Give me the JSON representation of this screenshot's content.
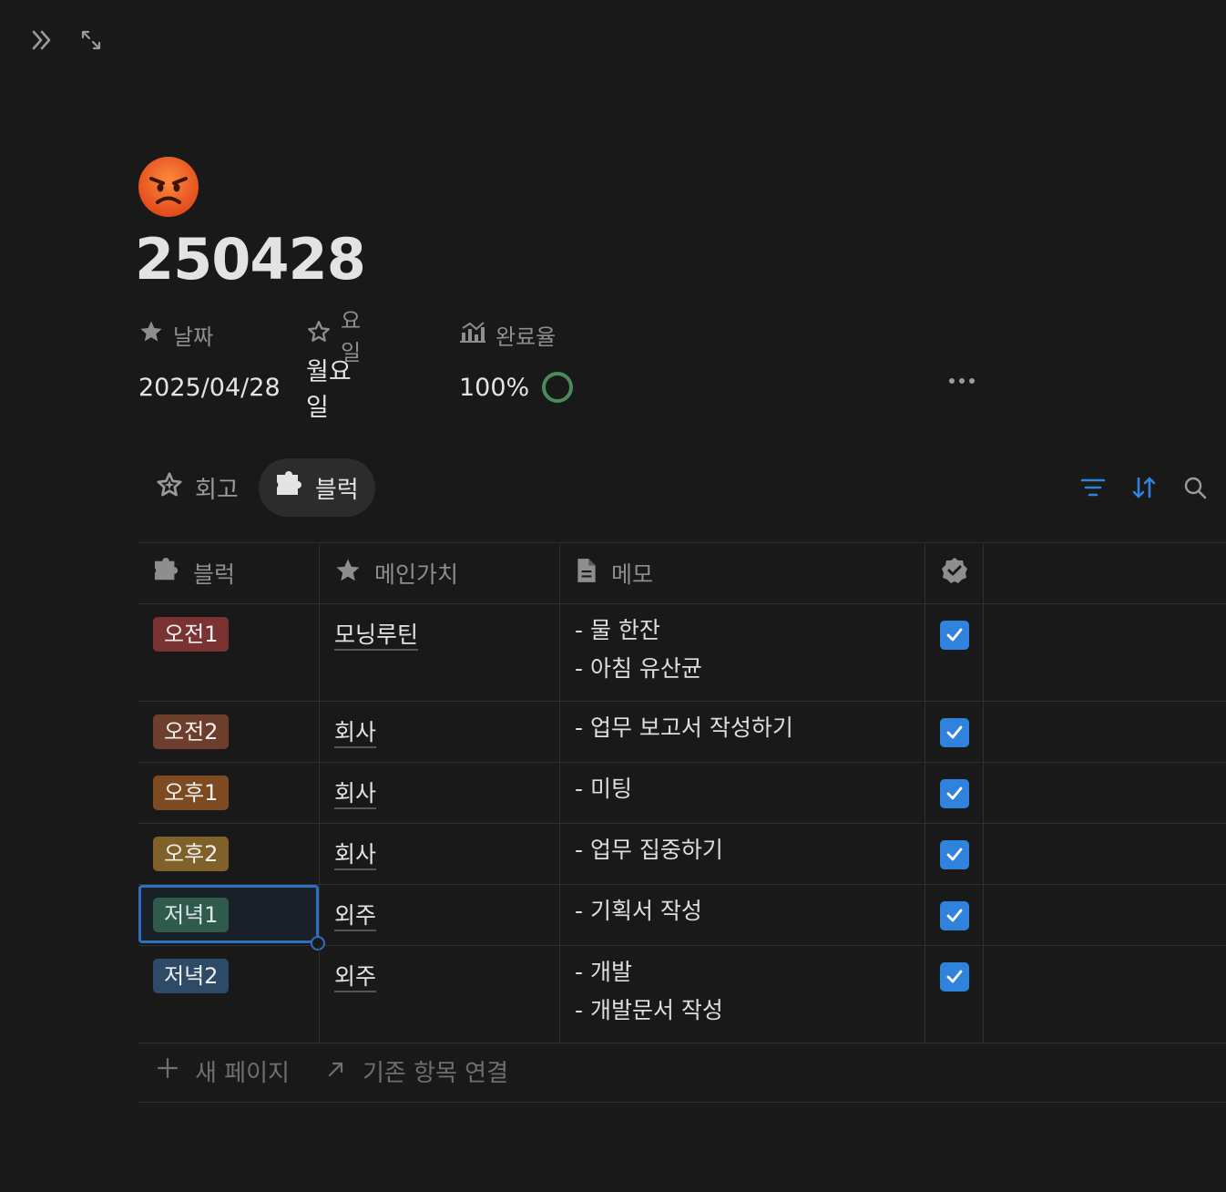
{
  "page": {
    "title": "250428"
  },
  "properties": [
    {
      "label": "날짜",
      "value": "2025/04/28",
      "icon": "star-filled-icon"
    },
    {
      "label": "요일",
      "value": "월요일",
      "icon": "star-outline-icon"
    },
    {
      "label": "완료율",
      "value": "100%",
      "icon": "chart-icon"
    }
  ],
  "tabs": [
    {
      "label": "회고",
      "icon": "sparkle-star-icon",
      "active": false
    },
    {
      "label": "블럭",
      "icon": "puzzle-icon",
      "active": true
    }
  ],
  "table": {
    "columns": [
      {
        "label": "블럭",
        "icon": "puzzle-icon"
      },
      {
        "label": "메인가치",
        "icon": "star-filled-icon"
      },
      {
        "label": "메모",
        "icon": "document-icon"
      },
      {
        "label": "",
        "icon": "verified-badge-icon"
      }
    ],
    "rows": [
      {
        "block": "오전1",
        "block_color": "#7a3232",
        "value": "모닝루틴",
        "memo": [
          "- 물 한잔",
          "- 아침 유산균"
        ],
        "done": true
      },
      {
        "block": "오전2",
        "block_color": "#6e3e2c",
        "value": "회사",
        "memo": [
          "- 업무 보고서 작성하기"
        ],
        "done": true
      },
      {
        "block": "오후1",
        "block_color": "#7e4a1f",
        "value": "회사",
        "memo": [
          "- 미팅"
        ],
        "done": true
      },
      {
        "block": "오후2",
        "block_color": "#80612a",
        "value": "회사",
        "memo": [
          "- 업무 집중하기"
        ],
        "done": true
      },
      {
        "block": "저녁1",
        "block_color": "#2f5a40",
        "value": "외주",
        "memo": [
          "- 기획서 작성"
        ],
        "done": true
      },
      {
        "block": "저녁2",
        "block_color": "#2d4a66",
        "value": "외주",
        "memo": [
          "- 개발",
          "- 개발문서 작성"
        ],
        "done": true
      }
    ]
  },
  "footer": {
    "new_page": "새 페이지",
    "link_existing": "기존 항목 연결"
  },
  "colors": {
    "accent": "#2f83dd",
    "ring": "#4a8a5c"
  }
}
